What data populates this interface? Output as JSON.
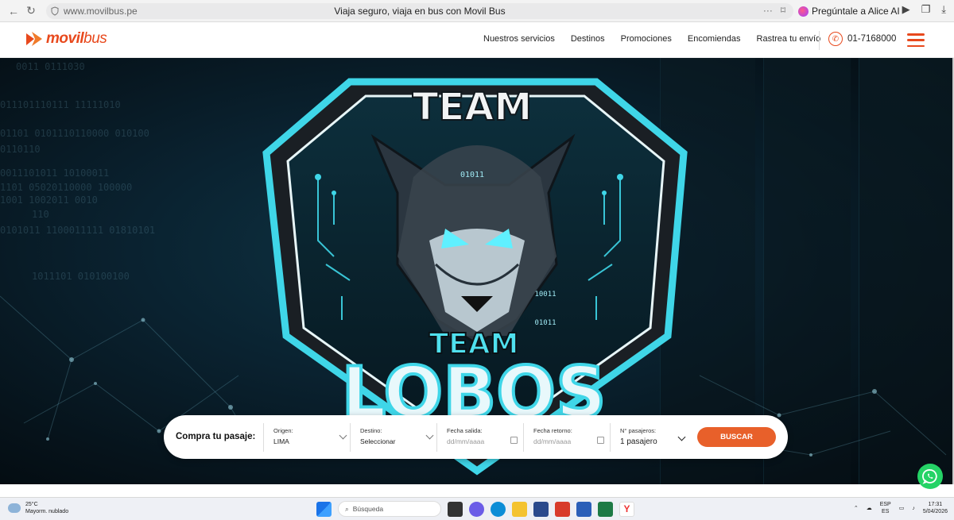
{
  "browser": {
    "url": "www.movilbus.pe",
    "tab_title": "Viaja seguro, viaja en bus con Movil Bus",
    "assistant_label": "Pregúntale a Alice AI"
  },
  "header": {
    "logo_bold": "movil",
    "logo_light": "bus",
    "nav": [
      "Nuestros servicios",
      "Destinos",
      "Promociones",
      "Encomiendas",
      "Rastrea tu envío"
    ],
    "phone": "01-7168000",
    "brand_color": "#e8491d"
  },
  "hero": {
    "binary_lines": [
      "0011 0111030",
      "011101110111 11111010",
      "01101 0101110110000 010100",
      "0110110",
      "0011101011 10100011",
      "1101 05020110000 100000",
      "1001 1002011 0010",
      "110",
      "0101011 1100011111 01810101",
      "1011101 010100100"
    ],
    "emblem_top": "TEAM",
    "emblem_middle": "TEAM",
    "emblem_bottom": "LOBOS",
    "emblem_code_1": "01011",
    "emblem_code_2": "10011",
    "emblem_code_3": "01011"
  },
  "booking": {
    "title": "Compra tu pasaje:",
    "origin_label": "Origen:",
    "origin_value": "LIMA",
    "dest_label": "Destino:",
    "dest_value": "Seleccionar",
    "depart_label": "Fecha salida:",
    "depart_placeholder": "dd/mm/aaaa",
    "return_label": "Fecha retorno:",
    "return_placeholder": "dd/mm/aaaa",
    "pax_label": "N° pasajeros:",
    "pax_value": "1 pasajero",
    "search_button": "BUSCAR",
    "button_color": "#e8602a"
  },
  "taskbar": {
    "temperature": "25°C",
    "weather": "Mayorm. nublado",
    "search_placeholder": "Búsqueda",
    "lang_top": "ESP",
    "lang_bottom": "ES",
    "time": "17:31",
    "date": "5/04/2026"
  }
}
